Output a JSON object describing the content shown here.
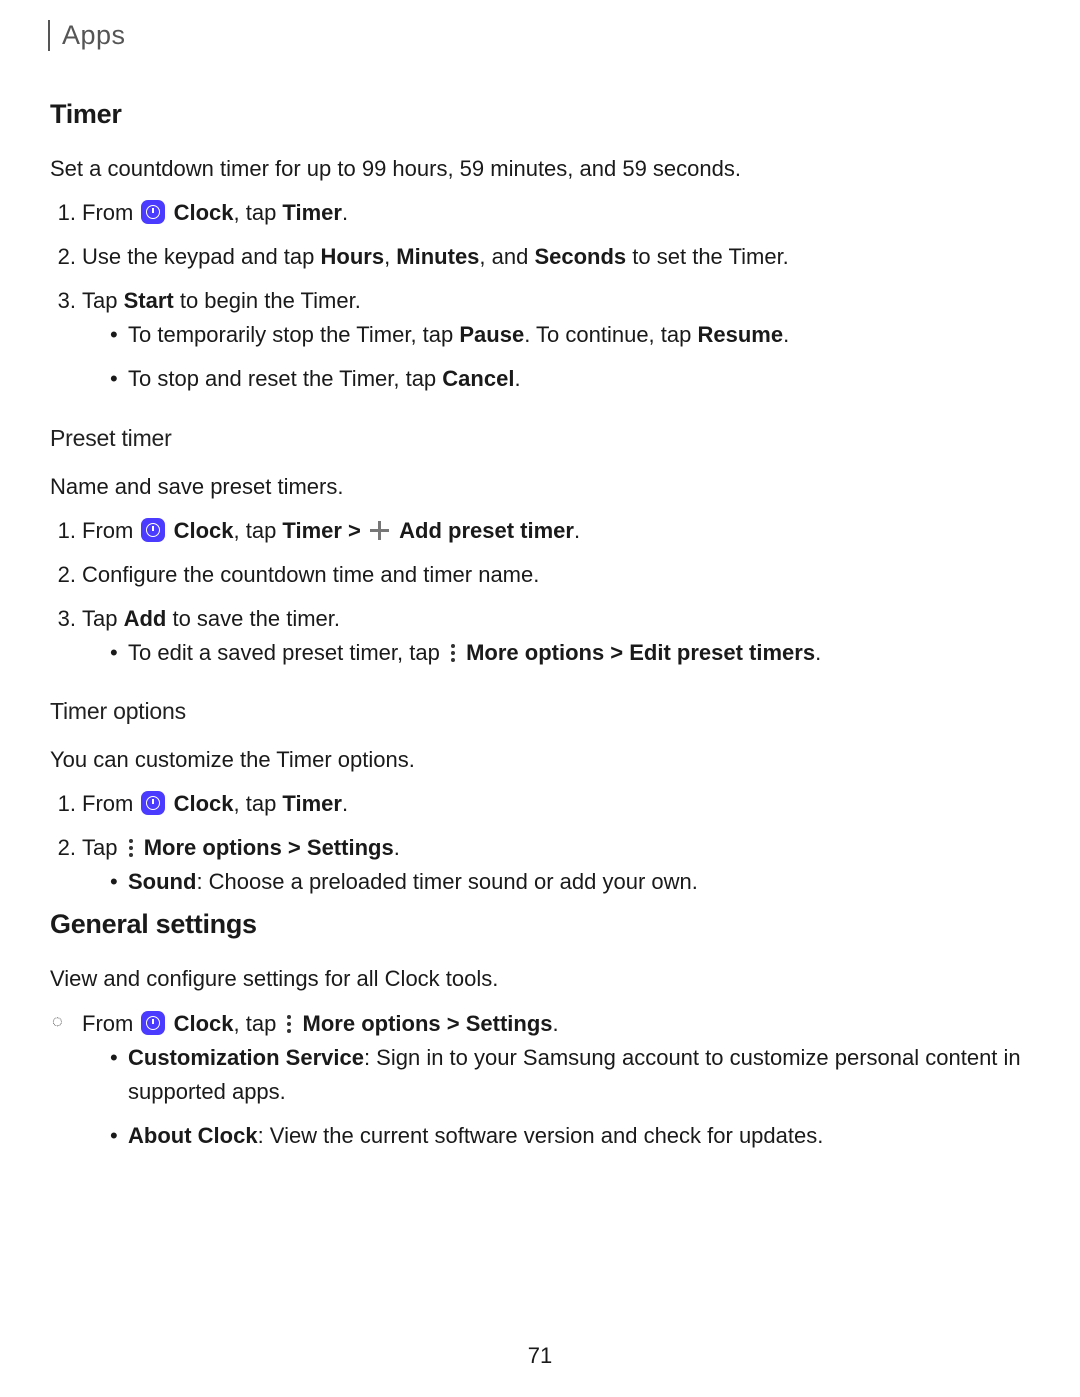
{
  "header": {
    "breadcrumb": "Apps"
  },
  "timer": {
    "title": "Timer",
    "intro": "Set a countdown timer for up to 99 hours, 59 minutes, and 59 seconds.",
    "steps": {
      "s1_from": "From ",
      "s1_clock": "Clock",
      "s1_tap": ", tap ",
      "s1_timer": "Timer",
      "s1_end": ".",
      "s2_a": "Use the keypad and tap ",
      "s2_hours": "Hours",
      "s2_b": ", ",
      "s2_minutes": "Minutes",
      "s2_c": ", and ",
      "s2_seconds": "Seconds",
      "s2_d": " to set the Timer.",
      "s3_a": "Tap ",
      "s3_start": "Start",
      "s3_b": " to begin the Timer."
    },
    "bullets": {
      "b1_a": "To temporarily stop the Timer, tap ",
      "b1_pause": "Pause",
      "b1_b": ". To continue, tap ",
      "b1_resume": "Resume",
      "b1_c": ".",
      "b2_a": "To stop and reset the Timer, tap ",
      "b2_cancel": "Cancel",
      "b2_b": "."
    }
  },
  "preset": {
    "title": "Preset timer",
    "intro": "Name and save preset timers.",
    "steps": {
      "s1_from": "From ",
      "s1_clock": "Clock",
      "s1_tap": ", tap ",
      "s1_timer": "Timer",
      "s1_chev": " > ",
      "s1_add": "Add preset timer",
      "s1_end": ".",
      "s2": "Configure the countdown time and timer name.",
      "s3_a": "Tap ",
      "s3_add": "Add",
      "s3_b": " to save the timer."
    },
    "bullets": {
      "b1_a": "To edit a saved preset timer, tap ",
      "b1_more": "More options > Edit preset timers",
      "b1_b": "."
    }
  },
  "options": {
    "title": "Timer options",
    "intro": "You can customize the Timer options.",
    "steps": {
      "s1_from": "From ",
      "s1_clock": "Clock",
      "s1_tap": ", tap ",
      "s1_timer": "Timer",
      "s1_end": ".",
      "s2_a": "Tap ",
      "s2_more": "More options > Settings",
      "s2_b": "."
    },
    "bullets": {
      "b1_sound": "Sound",
      "b1_rest": ": Choose a preloaded timer sound or add your own."
    }
  },
  "general": {
    "title": "General settings",
    "intro": "View and configure settings for all Clock tools.",
    "step": {
      "from": "From ",
      "clock": "Clock",
      "tap": ", tap ",
      "more": "More options > Settings",
      "end": "."
    },
    "bullets": {
      "b1_label": "Customization Service",
      "b1_rest": ": Sign in to your Samsung account to customize personal content in supported apps.",
      "b2_label": "About Clock",
      "b2_rest": ": View the current software version and check for updates."
    }
  },
  "page_number": "71"
}
